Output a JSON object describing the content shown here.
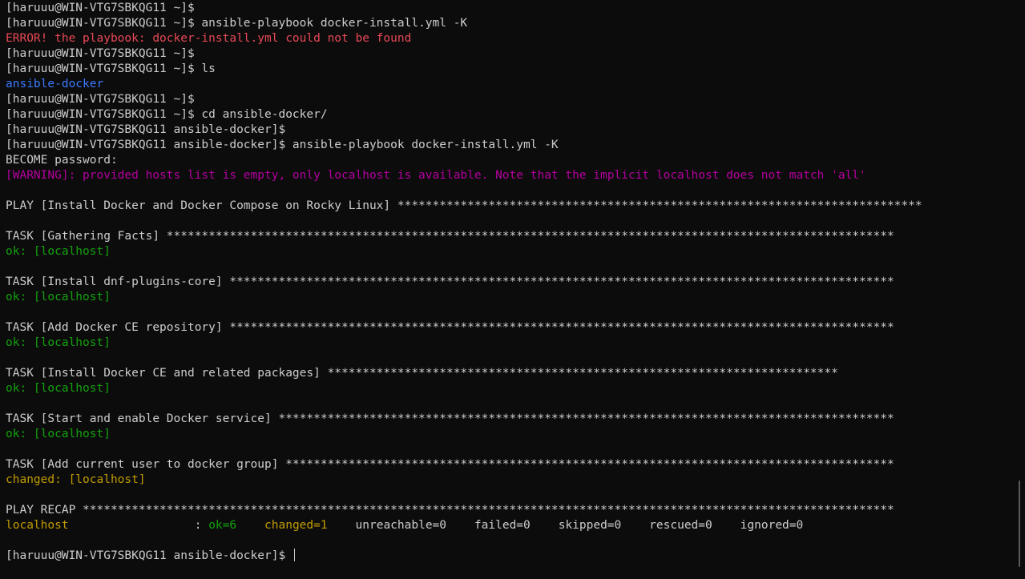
{
  "terminal": {
    "colors": {
      "background": "#0c0c0c",
      "default": "#cccccc",
      "red": "#e74856",
      "blue": "#3b78ff",
      "magenta": "#b4009e",
      "green": "#13a10e",
      "yellow": "#c19c00"
    },
    "lines": [
      [
        {
          "text": "[haruuu@WIN-VTG7SBKQG11 ~]$",
          "color": "default"
        }
      ],
      [
        {
          "text": "[haruuu@WIN-VTG7SBKQG11 ~]$ ansible-playbook docker-install.yml -K",
          "color": "default"
        }
      ],
      [
        {
          "text": "ERROR! the playbook: docker-install.yml could not be found",
          "color": "red"
        }
      ],
      [
        {
          "text": "[haruuu@WIN-VTG7SBKQG11 ~]$",
          "color": "default"
        }
      ],
      [
        {
          "text": "[haruuu@WIN-VTG7SBKQG11 ~]$ ls",
          "color": "default"
        }
      ],
      [
        {
          "text": "ansible-docker",
          "color": "blue"
        }
      ],
      [
        {
          "text": "[haruuu@WIN-VTG7SBKQG11 ~]$",
          "color": "default"
        }
      ],
      [
        {
          "text": "[haruuu@WIN-VTG7SBKQG11 ~]$ cd ansible-docker/",
          "color": "default"
        }
      ],
      [
        {
          "text": "[haruuu@WIN-VTG7SBKQG11 ansible-docker]$",
          "color": "default"
        }
      ],
      [
        {
          "text": "[haruuu@WIN-VTG7SBKQG11 ansible-docker]$ ansible-playbook docker-install.yml -K",
          "color": "default"
        }
      ],
      [
        {
          "text": "BECOME password:",
          "color": "default"
        }
      ],
      [
        {
          "text": "[WARNING]: provided hosts list is empty, only localhost is available. Note that the implicit localhost does not match 'all'",
          "color": "magenta"
        }
      ],
      [],
      [
        {
          "text": "PLAY [Install Docker and Docker Compose on Rocky Linux] ***************************************************************************",
          "color": "default"
        }
      ],
      [],
      [
        {
          "text": "TASK [Gathering Facts] ********************************************************************************************************",
          "color": "default"
        }
      ],
      [
        {
          "text": "ok: [localhost]",
          "color": "green"
        }
      ],
      [],
      [
        {
          "text": "TASK [Install dnf-plugins-core] ***********************************************************************************************",
          "color": "default"
        }
      ],
      [
        {
          "text": "ok: [localhost]",
          "color": "green"
        }
      ],
      [],
      [
        {
          "text": "TASK [Add Docker CE repository] ***********************************************************************************************",
          "color": "default"
        }
      ],
      [
        {
          "text": "ok: [localhost]",
          "color": "green"
        }
      ],
      [],
      [
        {
          "text": "TASK [Install Docker CE and related packages] *************************************************************************",
          "color": "default"
        }
      ],
      [
        {
          "text": "ok: [localhost]",
          "color": "green"
        }
      ],
      [],
      [
        {
          "text": "TASK [Start and enable Docker service] ****************************************************************************************",
          "color": "default"
        }
      ],
      [
        {
          "text": "ok: [localhost]",
          "color": "green"
        }
      ],
      [],
      [
        {
          "text": "TASK [Add current user to docker group] ***************************************************************************************",
          "color": "default"
        }
      ],
      [
        {
          "text": "changed: [localhost]",
          "color": "yellow"
        }
      ],
      [],
      [
        {
          "text": "PLAY RECAP ********************************************************************************************************************",
          "color": "default"
        }
      ],
      [
        {
          "text": "localhost",
          "color": "yellow"
        },
        {
          "text": "                  : ",
          "color": "default"
        },
        {
          "text": "ok=6",
          "color": "green"
        },
        {
          "text": "    ",
          "color": "default"
        },
        {
          "text": "changed=1",
          "color": "yellow"
        },
        {
          "text": "    unreachable=0    failed=0    skipped=0    rescued=0    ignored=0",
          "color": "default"
        }
      ],
      [],
      [
        {
          "text": "[haruuu@WIN-VTG7SBKQG11 ansible-docker]$ ",
          "color": "default"
        }
      ]
    ]
  }
}
